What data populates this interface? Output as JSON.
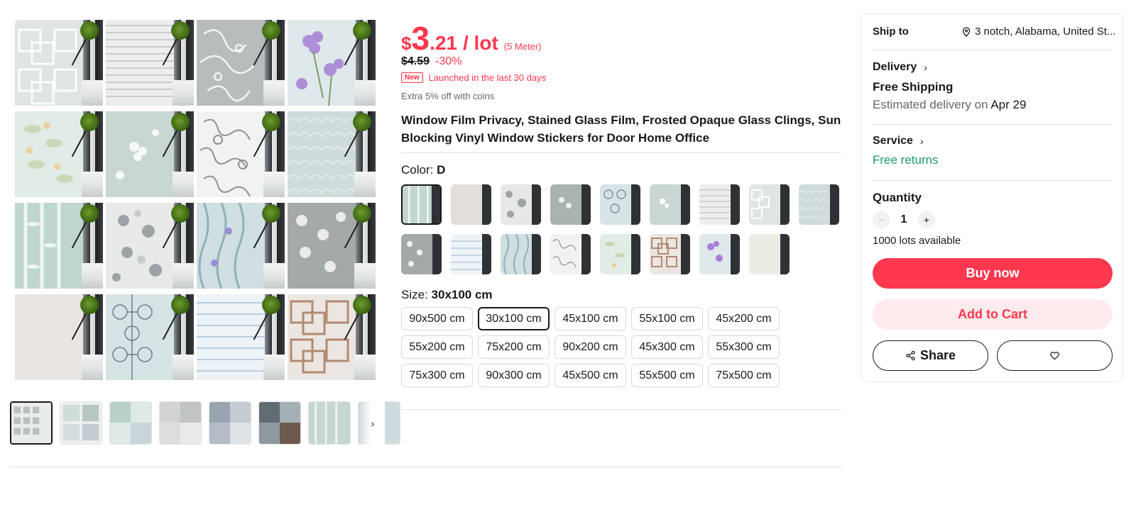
{
  "price": {
    "currency": "$",
    "integer": "3",
    "decimal": ".21",
    "unit": "/ lot",
    "unit_note": "(5 Meter)",
    "original": "$4.59",
    "discount": "-30%",
    "new_badge": "New",
    "launched": "Launched in the last 30 days",
    "coins": "Extra 5% off with coins"
  },
  "product_title": "Window Film Privacy, Stained Glass Film, Frosted Opaque Glass Clings, Sun Blocking Vinyl Window Stickers for Door Home Office",
  "color": {
    "label": "Color: ",
    "selected": "D"
  },
  "size": {
    "label": "Size: ",
    "selected": "30x100 cm",
    "options": [
      "90x500 cm",
      "30x100 cm",
      "45x100 cm",
      "55x100 cm",
      "45x200 cm",
      "55x200 cm",
      "75x200 cm",
      "90x200 cm",
      "45x300 cm",
      "55x300 cm",
      "75x300 cm",
      "90x300 cm",
      "45x500 cm",
      "55x500 cm",
      "75x500 cm"
    ]
  },
  "panel": {
    "ship_to_label": "Ship to",
    "ship_to_location": "3 notch, Alabama, United St...",
    "delivery_label": "Delivery",
    "free_shipping": "Free Shipping",
    "estimated_prefix": "Estimated delivery on ",
    "estimated_date": "Apr 29",
    "service_label": "Service",
    "free_returns": "Free returns",
    "quantity_label": "Quantity",
    "quantity_value": "1",
    "minus": "−",
    "plus": "+",
    "available": "1000 lots available",
    "buy_now": "Buy now",
    "add_to_cart": "Add to Cart",
    "share": "Share",
    "chevron": "›"
  },
  "gallery_next": "›",
  "colors": {
    "accent": "#fd384f",
    "green": "#1e9b6a",
    "text": "#191919",
    "muted": "#666666"
  }
}
